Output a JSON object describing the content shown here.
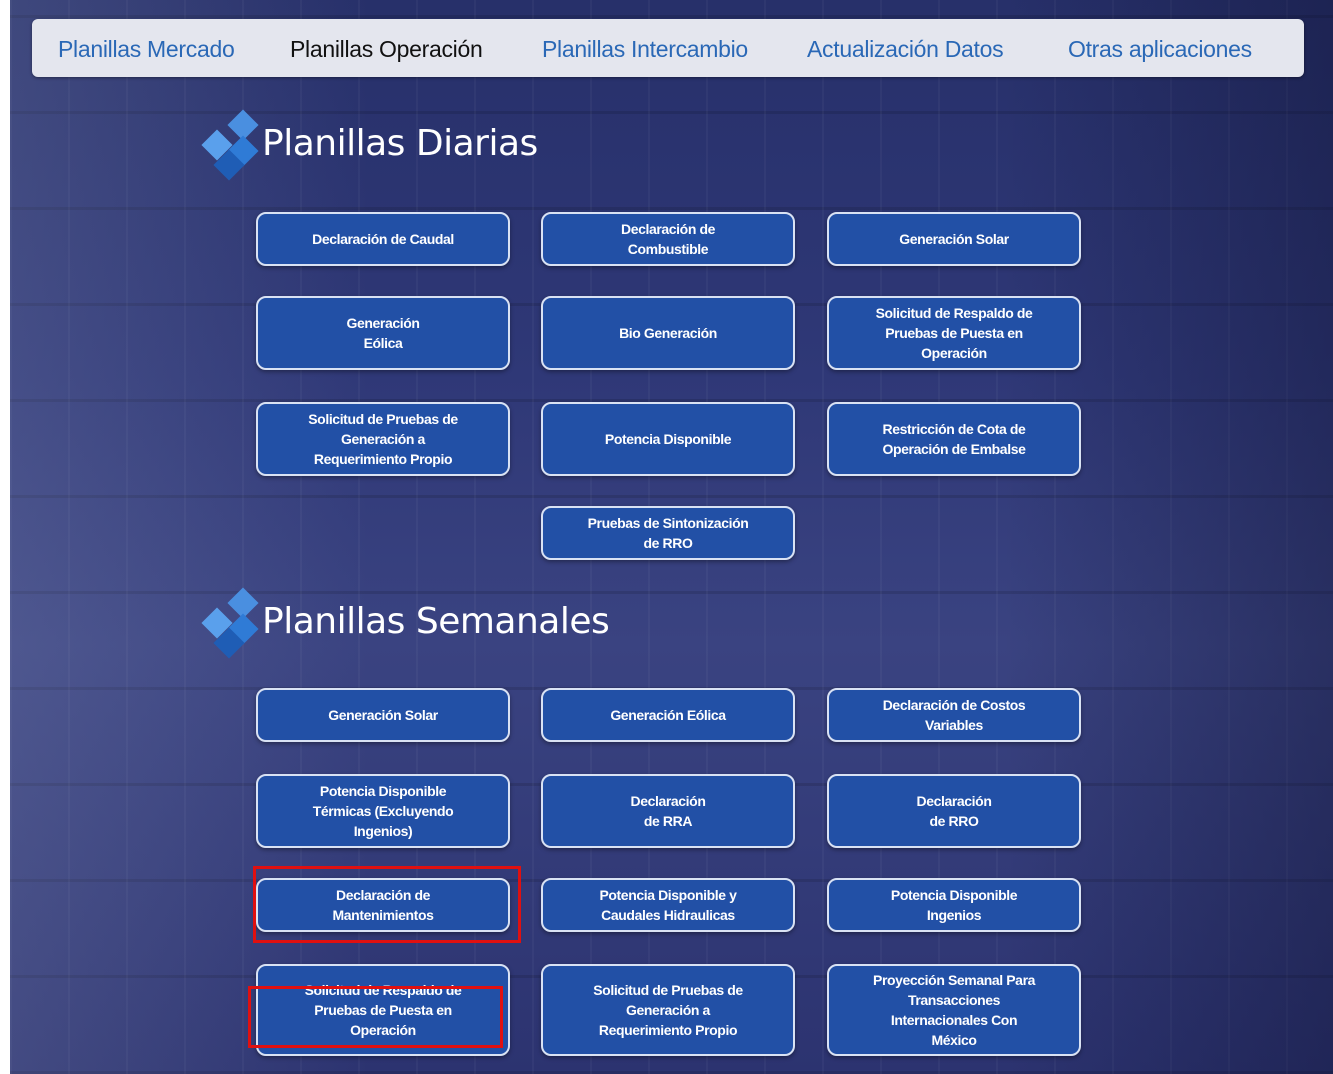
{
  "nav": {
    "items": [
      {
        "label": "Planillas Mercado",
        "active": false
      },
      {
        "label": "Planillas Operación",
        "active": true
      },
      {
        "label": "Planillas Intercambio",
        "active": false
      },
      {
        "label": "Actualización Datos",
        "active": false
      },
      {
        "label": "Otras aplicaciones",
        "active": false
      }
    ]
  },
  "diarias": {
    "title": "Planillas Diarias",
    "buttons": [
      "Declaración de Caudal",
      "Declaración de\nCombustible",
      "Generación Solar",
      "Generación\nEólica",
      "Bio Generación",
      "Solicitud de Respaldo de\nPruebas de Puesta en\nOperación",
      "Solicitud de Pruebas de\nGeneración a\nRequerimiento Propio",
      "Potencia Disponible",
      "Restricción de Cota de\nOperación de Embalse",
      "Pruebas de Sintonización\nde RRO"
    ]
  },
  "semanales": {
    "title": "Planillas Semanales",
    "buttons": [
      "Generación Solar",
      "Generación Eólica",
      "Declaración de Costos\nVariables",
      "Potencia Disponible\nTérmicas (Excluyendo\nIngenios)",
      "Declaración\nde RRA",
      "Declaración\nde RRO",
      "Declaración de\nMantenimientos",
      "Potencia Disponible y\nCaudales Hidraulicas",
      "Potencia Disponible\nIngenios",
      "Solicitud de Respaldo de\nPruebas de Puesta en\nOperación",
      "Solicitud de Pruebas de\nGeneración a\nRequerimiento Propio",
      "Proyección Semanal Para\nTransacciones\nInternacionales Con\nMéxico"
    ]
  },
  "colors": {
    "button_fill": "#2250a6",
    "nav_link": "#2a68b6",
    "highlight": "#e01010"
  }
}
